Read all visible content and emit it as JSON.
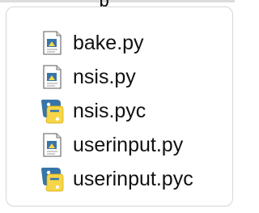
{
  "header": {
    "fragment": "p"
  },
  "files": [
    {
      "name": "bake.py",
      "icon": "python-script-file-icon"
    },
    {
      "name": "nsis.py",
      "icon": "python-script-file-icon"
    },
    {
      "name": "nsis.pyc",
      "icon": "python-compiled-file-icon"
    },
    {
      "name": "userinput.py",
      "icon": "python-script-file-icon"
    },
    {
      "name": "userinput.pyc",
      "icon": "python-compiled-file-icon"
    }
  ],
  "colors": {
    "python_blue": "#3775a9",
    "python_yellow": "#f7d548",
    "file_border": "#7a7a7a",
    "file_fold": "#d8d8d8",
    "text": "#111111"
  }
}
